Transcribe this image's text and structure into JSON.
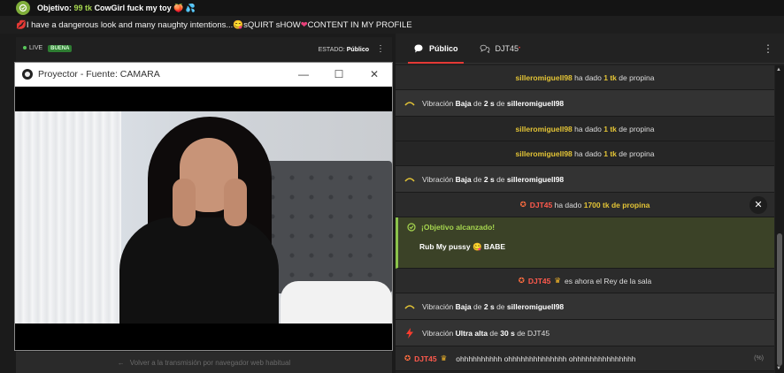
{
  "goal_bar": {
    "prefix": "Objetivo:",
    "tk": "99 tk",
    "text": "CowGirl fuck my toy 🍑 💦"
  },
  "subject": {
    "pre_emoji": "💋",
    "text_1": "I have a dangerous look and many naughty intentions...",
    "emoji": "😋",
    "text_2": " sQUIRT sHOW",
    "heart": "❤",
    "text_3": " CONTENT IN MY PROFILE"
  },
  "stream_header": {
    "live_label": "LIVE",
    "quality_badge": "BUENA",
    "estado_label": "ESTADO:",
    "estado_value": "Público",
    "menu_icon": "⋮"
  },
  "projector": {
    "title": "Proyector - Fuente: CAMARA",
    "minimize": "—",
    "maximize": "☐",
    "close": "✕"
  },
  "back_bar": {
    "arrow": "←",
    "text": "Volver a la transmisión por navegador web habitual"
  },
  "chat": {
    "tabs": [
      {
        "label": "Público",
        "icon": "chat-bubble-icon"
      },
      {
        "label": "DJT45",
        "icon": "private-chat-icon",
        "sup": "•"
      }
    ],
    "menu_icon": "⋮",
    "messages": [
      {
        "type": "tip",
        "user": "silleromiguell98",
        "mid": "ha dado",
        "amount": "1 tk",
        "end": "de propina"
      },
      {
        "type": "vib",
        "pre": "Vibración",
        "level": "Baja",
        "de": "de",
        "secs": "2 s",
        "de2": "de",
        "user": "silleromiguell98"
      },
      {
        "type": "tip",
        "user": "silleromiguell98",
        "mid": "ha dado",
        "amount": "1 tk",
        "end": "de propina"
      },
      {
        "type": "tip",
        "user": "silleromiguell98",
        "mid": "ha dado",
        "amount": "1 tk",
        "end": "de propina"
      },
      {
        "type": "vib",
        "pre": "Vibración",
        "level": "Baja",
        "de": "de",
        "secs": "2 s",
        "de2": "de",
        "user": "silleromiguell98"
      },
      {
        "type": "tip_red",
        "user": "DJT45",
        "mid": "ha dado",
        "amount": "1700 tk",
        "end": "de propina",
        "close": "✕"
      },
      {
        "type": "goal",
        "title": "¡Objetivo alcanzado!",
        "text": "Rub My pussy 😋 BABE"
      },
      {
        "type": "king",
        "user": "DJT45",
        "text": "es ahora el Rey de la sala"
      },
      {
        "type": "vib",
        "pre": "Vibración",
        "level": "Baja",
        "de": "de",
        "secs": "2 s",
        "de2": "de",
        "user": "silleromiguell98"
      },
      {
        "type": "vib_ultra",
        "pre": "Vibración",
        "level": "Ultra alta",
        "de": "de",
        "secs": "30 s",
        "de2": "de",
        "user": "DJT45"
      },
      {
        "type": "chat",
        "user": "DJT45",
        "text": "ohhhhhhhhhh ohhhhhhhhhhhhhh ohhhhhhhhhhhhhhh",
        "flag": "(%)"
      }
    ]
  },
  "colors": {
    "accent_red": "#e53935",
    "tip_yellow": "#e3c436",
    "goal_green": "#a6d64f"
  }
}
